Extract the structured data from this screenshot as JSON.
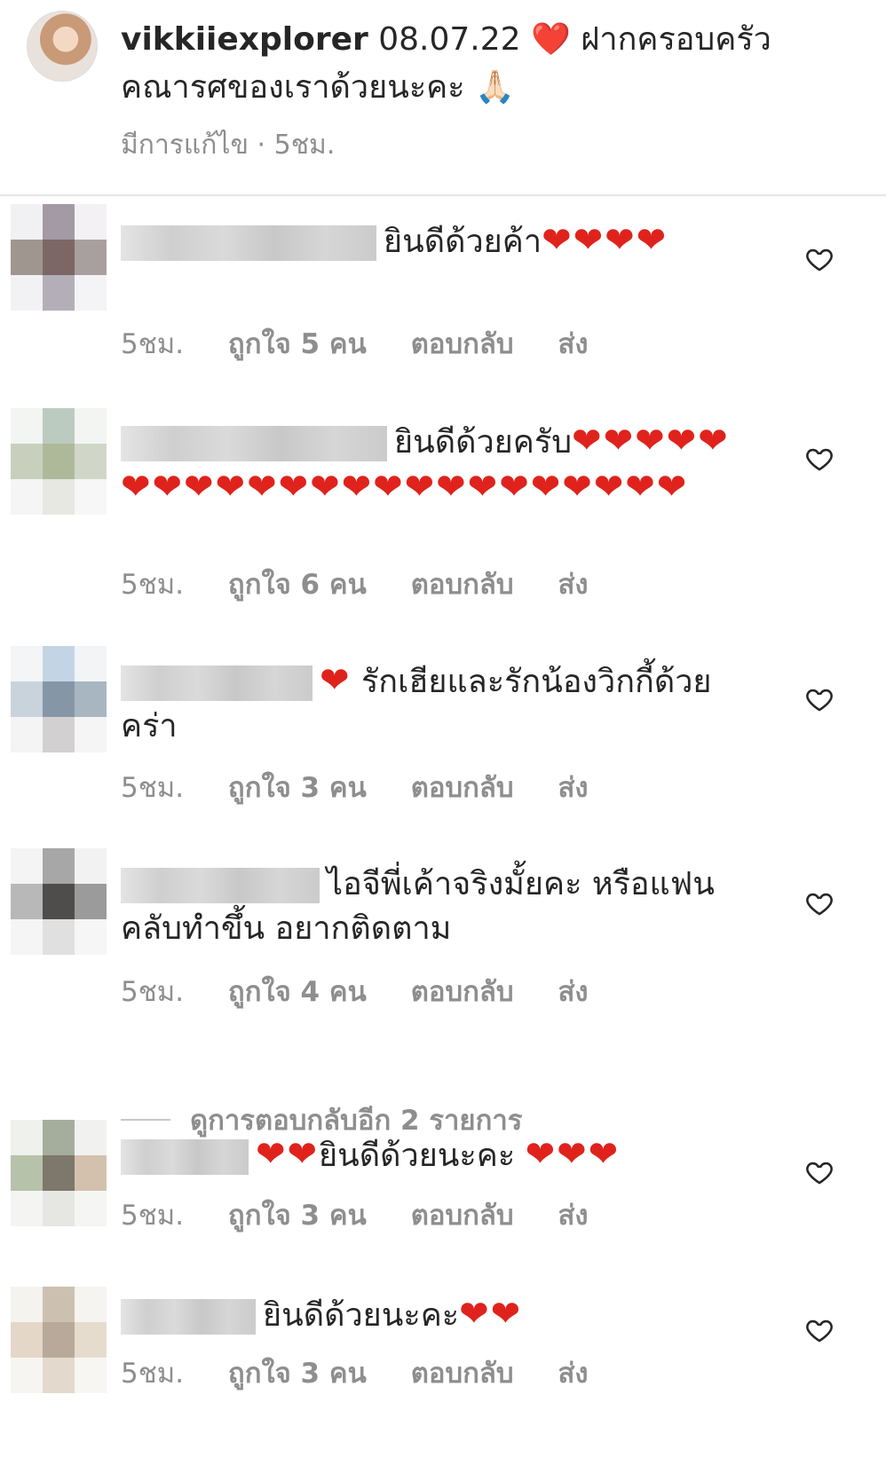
{
  "caption": {
    "username": "vikkiiexplorer",
    "text": "08.07.22 ❤️ ฝากครอบครัวคณารศของเราด้วยนะคะ 🙏🏻",
    "meta": "มีการแก้ไข · 5ชม."
  },
  "comments": [
    {
      "text": "ยินดีด้วยค้า",
      "hearts": "❤❤❤❤",
      "time": "5ชม.",
      "likes": "ถูกใจ 5 คน",
      "reply": "ตอบกลับ",
      "send": "ส่ง"
    },
    {
      "text": "ยินดีด้วยครับ",
      "hearts": "❤❤❤❤❤❤❤❤❤❤❤❤❤❤❤❤❤❤❤❤❤❤❤",
      "time": "5ชม.",
      "likes": "ถูกใจ 6 คน",
      "reply": "ตอบกลับ",
      "send": "ส่ง"
    },
    {
      "hearts_lead": "❤",
      "text": "รักเฮียและรักน้องวิกกี้ด้วยคร่า",
      "time": "5ชม.",
      "likes": "ถูกใจ 3 คน",
      "reply": "ตอบกลับ",
      "send": "ส่ง"
    },
    {
      "text": "ไอจีพี่เค้าจริงมั้ยคะ หรือแฟนคลับทำขึ้น อยากติดตาม",
      "time": "5ชม.",
      "likes": "ถูกใจ 4 คน",
      "reply": "ตอบกลับ",
      "send": "ส่ง"
    },
    {
      "hearts_lead": "❤❤",
      "text": "ยินดีด้วยนะคะ",
      "hearts": "❤❤❤",
      "time": "5ชม.",
      "likes": "ถูกใจ 3 คน",
      "reply": "ตอบกลับ",
      "send": "ส่ง"
    },
    {
      "text": "ยินดีด้วยนะคะ",
      "hearts": "❤❤",
      "time": "5ชม.",
      "likes": "ถูกใจ 3 คน",
      "reply": "ตอบกลับ",
      "send": "ส่ง"
    }
  ],
  "more_replies": "ดูการตอบกลับอีก 2 รายการ",
  "colors": {
    "heart": "#e0221c",
    "secondary_text": "#8e8e8e",
    "primary_text": "#262626"
  },
  "icons": [
    "heart-outline-icon",
    "red-heart-emoji",
    "folded-hands-emoji"
  ]
}
